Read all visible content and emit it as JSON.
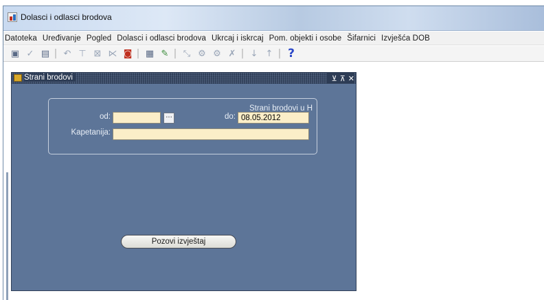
{
  "window": {
    "title": "Dolasci i odlasci brodova"
  },
  "menubar": {
    "items": [
      "Datoteka",
      "Uređivanje",
      "Pogled",
      "Dolasci i odlasci brodova",
      "Ukrcaj i iskrcaj",
      "Pom. objekti i osobe",
      "Šifarnici",
      "Izvješća DOB"
    ]
  },
  "toolbar": {
    "icons": [
      "save-icon",
      "commit-icon",
      "print-icon",
      "undo-icon",
      "enter-query-icon",
      "execute-query-icon",
      "cancel-query-icon",
      "form-icon",
      "list-icon",
      "edit-icon",
      "clear-icon",
      "duplicate-icon",
      "delete-record-icon",
      "next-icon",
      "previous-icon",
      "help-icon"
    ],
    "help_glyph": "?"
  },
  "form": {
    "title": "Strani brodovi",
    "group_label": "Strani brodovi u H",
    "od_label": "od:",
    "od_value": "",
    "lov_glyph": "···",
    "do_label": "do:",
    "do_value": "08.05.2012",
    "kapetanija_label": "Kapetanija:",
    "kapetanija_value": "",
    "report_button": "Pozovi izvještaj"
  },
  "colors": {
    "form_bg": "#5d7598",
    "form_title_bg": "#2d3c55",
    "field_bg": "#fbeec8"
  }
}
